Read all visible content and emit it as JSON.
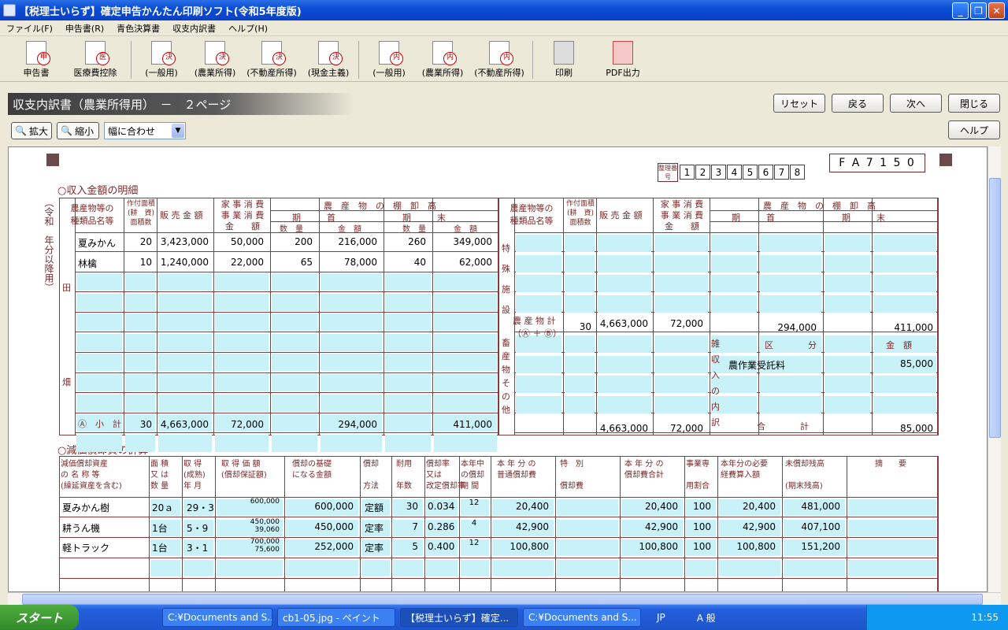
{
  "window": {
    "title": "【税理士いらず】確定申告かんたん印刷ソフト(令和5年度版)"
  },
  "menu": [
    "ファイル(F)",
    "申告書(R)",
    "青色決算書",
    "収支内訳書",
    "ヘルプ(H)"
  ],
  "toolbar": [
    {
      "label": "申告書",
      "glyph": "申"
    },
    {
      "label": "医療費控除",
      "glyph": "医"
    },
    {
      "label": "(一般用)",
      "glyph": "決"
    },
    {
      "label": "(農業所得)",
      "glyph": "決"
    },
    {
      "label": "(不動産所得)",
      "glyph": "決"
    },
    {
      "label": "(現金主義)",
      "glyph": "決"
    },
    {
      "label": "(一般用)",
      "glyph": "内"
    },
    {
      "label": "(農業所得)",
      "glyph": "内"
    },
    {
      "label": "(不動産所得)",
      "glyph": "内"
    },
    {
      "label": "印刷",
      "glyph": ""
    },
    {
      "label": "PDF出力",
      "glyph": ""
    }
  ],
  "header": {
    "title": "収支内訳書（農業所得用）　－　２ページ"
  },
  "nav": {
    "reset": "リセット",
    "back": "戻る",
    "next": "次へ",
    "close": "閉じる",
    "help": "ヘルプ"
  },
  "zoom": {
    "in": "拡大",
    "out": "縮小",
    "fit": "幅に合わせ"
  },
  "form": {
    "code": "F A 7 1 5 0",
    "seiri_label": "整理番号",
    "digits": [
      "1",
      "2",
      "3",
      "4",
      "5",
      "6",
      "7",
      "8"
    ],
    "sec1": "○収入金額の明細",
    "sec2": "○減価償却費の計算",
    "era": "（令和　年分以降用）",
    "rows": [
      {
        "name": "夏みかん",
        "area": "20",
        "sales": "3,423,000",
        "self": "50,000",
        "q1": "200",
        "a1": "216,000",
        "q2": "260",
        "a2": "349,000"
      },
      {
        "name": "林檎",
        "area": "10",
        "sales": "1,240,000",
        "self": "22,000",
        "q1": "65",
        "a1": "78,000",
        "q2": "40",
        "a2": "62,000"
      }
    ],
    "subtotal": {
      "label": "小　計",
      "area": "30",
      "sales": "4,663,000",
      "self": "72,000",
      "a1": "294,000",
      "a2": "411,000"
    },
    "right": {
      "noutotal_label": "農 産 物 計\n（Ⓐ ＋ Ⓑ）",
      "area": "30",
      "sales": "4,663,000",
      "self": "72,000",
      "r5": "294,000",
      "r6": "411,000",
      "misc_item": "農作業受託料",
      "misc_amount": "85,000",
      "g1": "4,663,000",
      "g2": "72,000",
      "g3": "85,000"
    },
    "dep": [
      {
        "name": "夏みかん樹",
        "qty": "20ａ",
        "date": "29・3",
        "cost": "600,000",
        "cost2": "",
        "base": "600,000",
        "method": "定額",
        "life": "30",
        "rate": "0.034",
        "months": "12",
        "common": "20,400",
        "total": "20,400",
        "ratio": "100",
        "exp": "20,400",
        "remain": "481,000"
      },
      {
        "name": "耕うん機",
        "qty": "1台",
        "date": "5・9",
        "cost": "450,000",
        "cost2": "39,060",
        "base": "450,000",
        "method": "定率",
        "life": "7",
        "rate": "0.286",
        "months": "4",
        "common": "42,900",
        "total": "42,900",
        "ratio": "100",
        "exp": "42,900",
        "remain": "407,100"
      },
      {
        "name": "軽トラック",
        "qty": "1台",
        "date": "3・1",
        "cost": "700,000",
        "cost2": "75,600",
        "base": "252,000",
        "method": "定率",
        "life": "5",
        "rate": "0.400",
        "months": "12",
        "common": "100,800",
        "total": "100,800",
        "ratio": "100",
        "exp": "100,800",
        "remain": "151,200"
      }
    ]
  },
  "taskbar": {
    "start": "スタート",
    "tasks": [
      "C:¥Documents and S...",
      "cb1-05.jpg - ペイント",
      "【税理士いらず】確定...",
      "C:¥Documents and S..."
    ],
    "lang": "JP",
    "ime": "A 般",
    "clock": "11:55"
  }
}
